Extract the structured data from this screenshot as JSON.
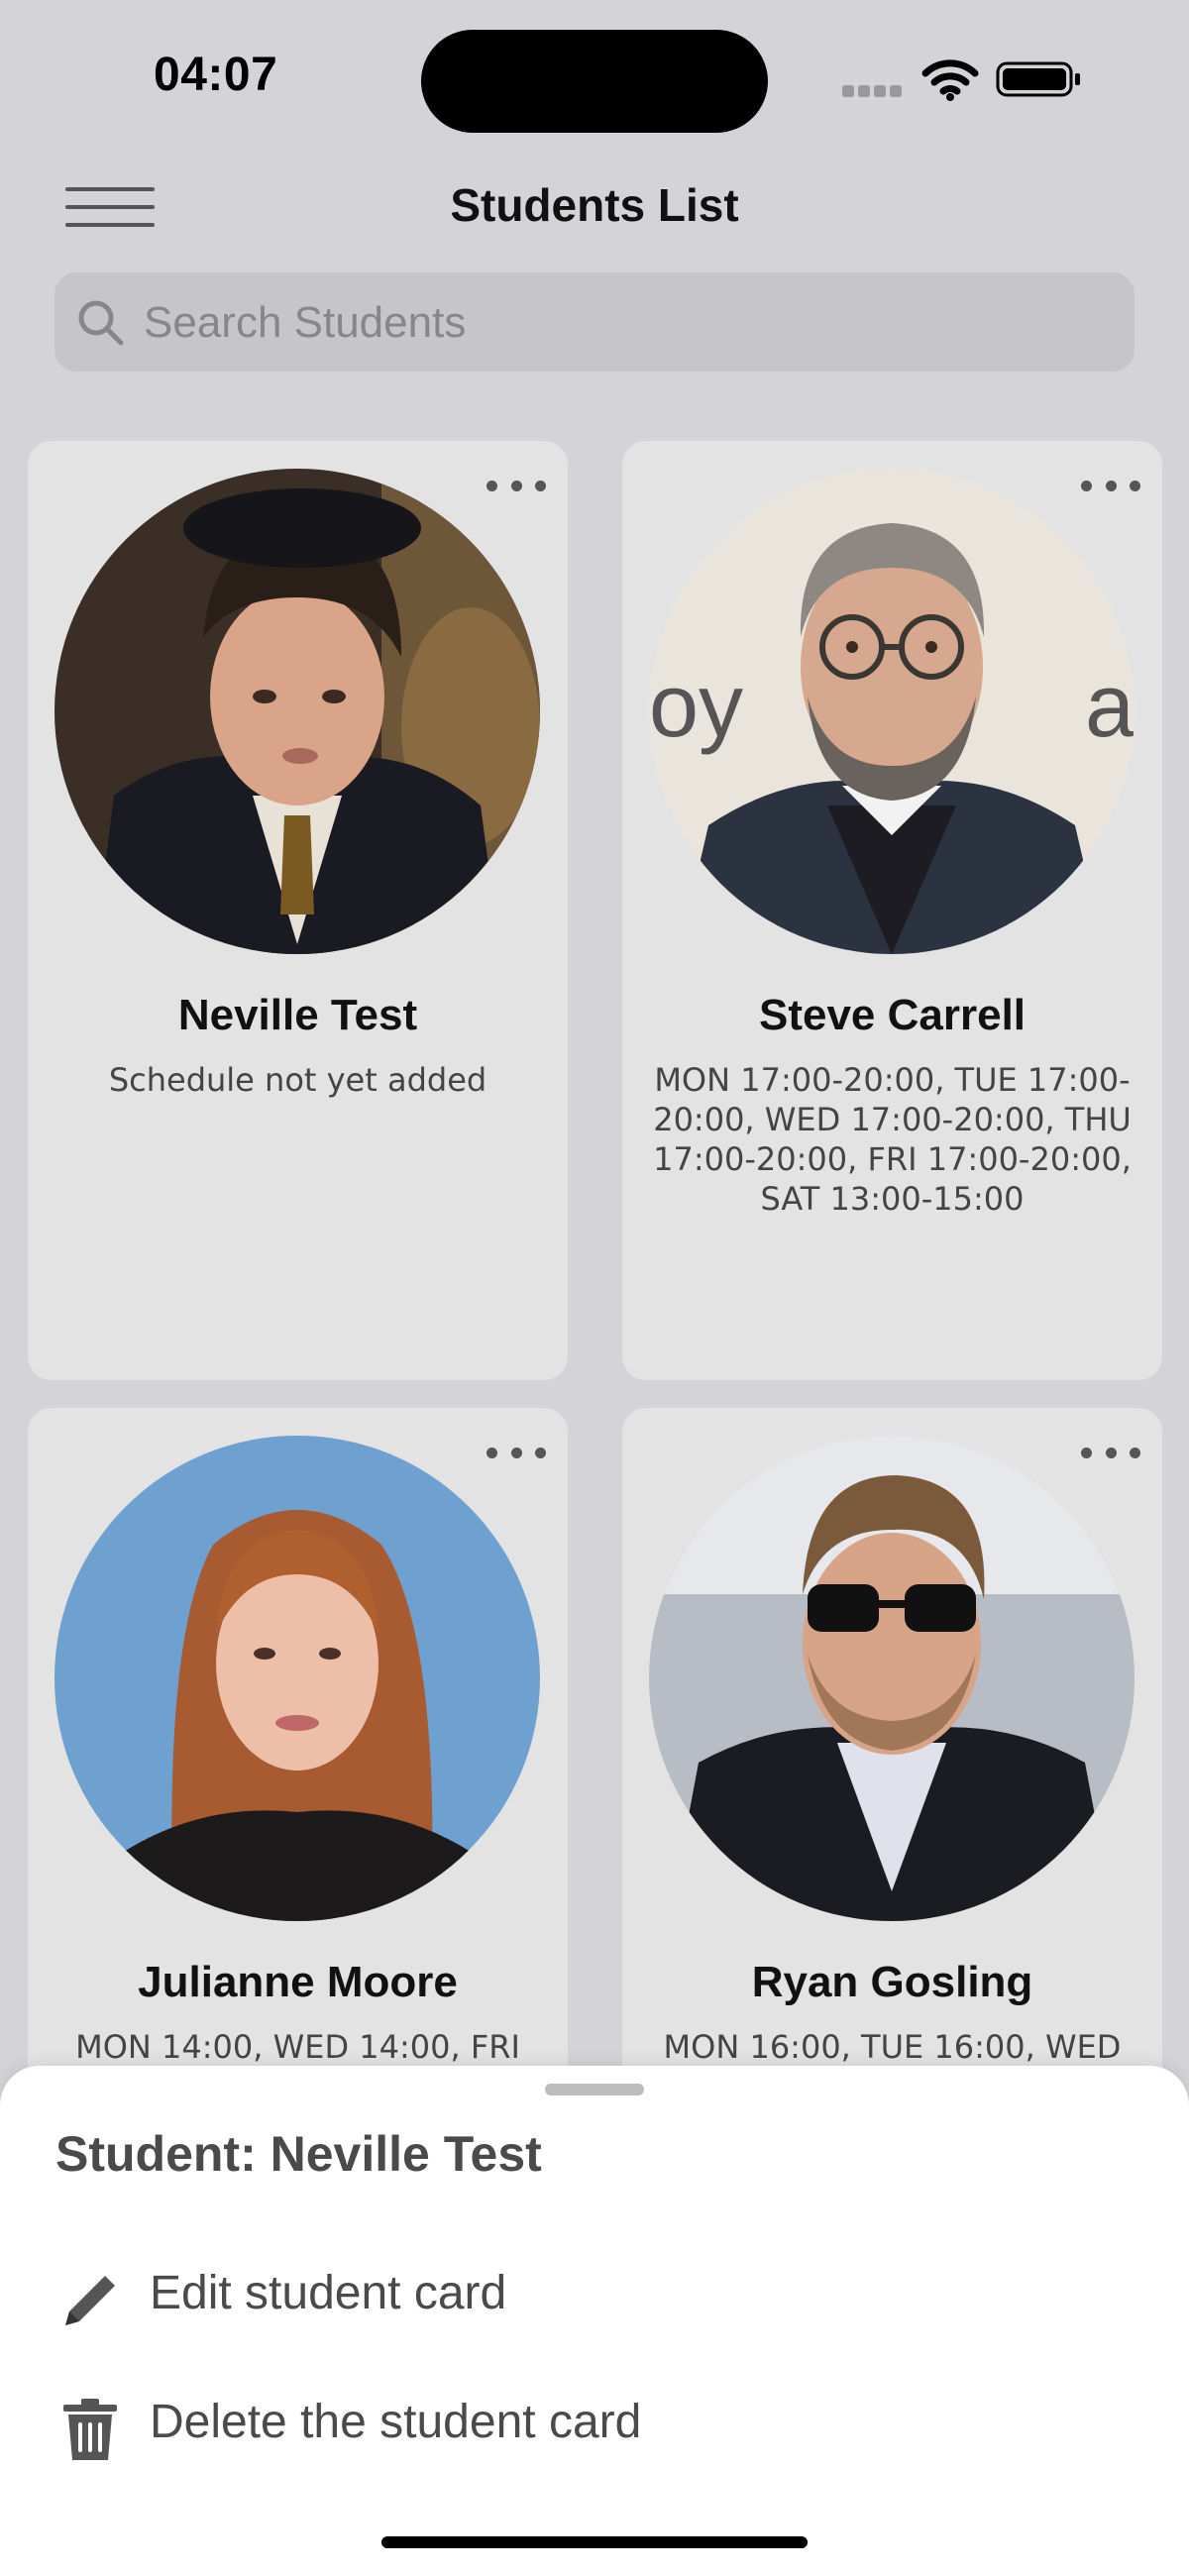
{
  "status_bar": {
    "time": "04:07",
    "signal_icon": "cellular-signal-icon",
    "wifi_icon": "wifi-icon",
    "battery_icon": "battery-icon"
  },
  "header": {
    "menu_icon": "hamburger-menu-icon",
    "title": "Students List"
  },
  "search": {
    "icon": "search-icon",
    "placeholder": "Search Students",
    "value": ""
  },
  "students": [
    {
      "name": "Neville Test",
      "schedule": "Schedule not yet added",
      "avatar": "student-photo",
      "more_icon": "more-horizontal-icon"
    },
    {
      "name": "Steve Carrell",
      "schedule": "MON 17:00-20:00, TUE 17:00-20:00, WED 17:00-20:00, THU 17:00-20:00, FRI 17:00-20:00, SAT 13:00-15:00",
      "avatar": "student-photo",
      "more_icon": "more-horizontal-icon"
    },
    {
      "name": "Julianne Moore",
      "schedule": "MON 14:00, WED 14:00, FRI",
      "avatar": "student-photo",
      "more_icon": "more-horizontal-icon"
    },
    {
      "name": "Ryan Gosling",
      "schedule": "MON 16:00, TUE 16:00, WED",
      "avatar": "student-photo",
      "more_icon": "more-horizontal-icon"
    }
  ],
  "bottom_sheet": {
    "title": "Student: Neville Test",
    "actions": [
      {
        "label": "Edit student card",
        "icon": "pencil-icon"
      },
      {
        "label": "Delete the student card",
        "icon": "trash-icon"
      }
    ]
  },
  "colors": {
    "background": "#d4d4d8",
    "card": "#e3e3e3",
    "search_field": "#c6c6ca",
    "sheet": "#ffffff",
    "sheet_text": "#4a4a4a"
  }
}
